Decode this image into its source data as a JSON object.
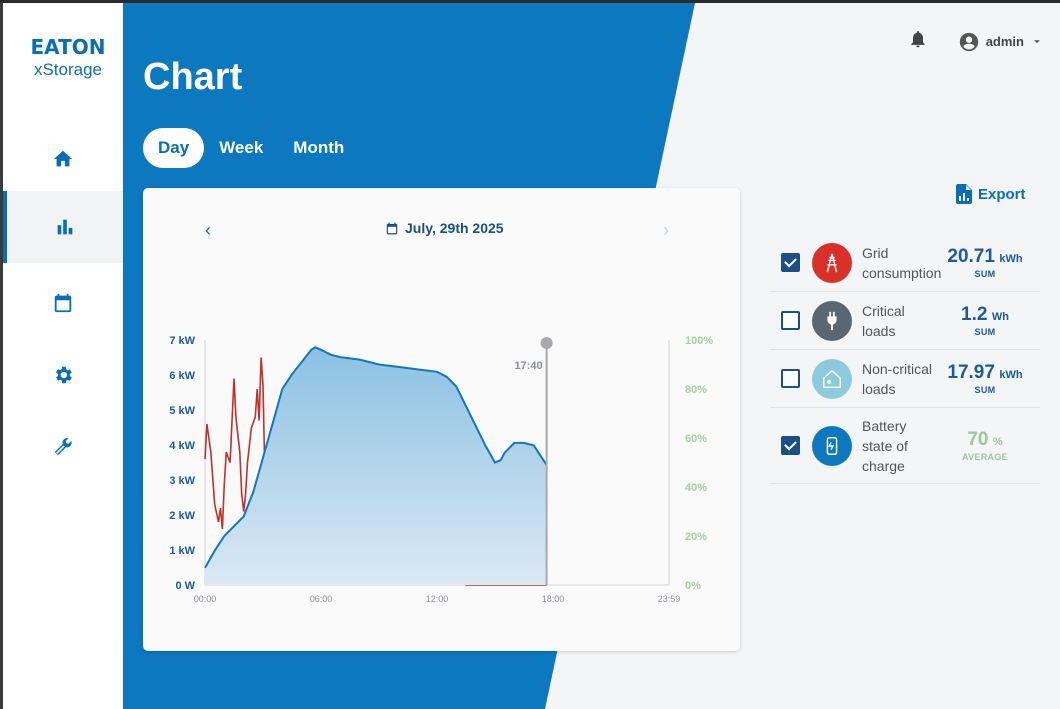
{
  "app": {
    "brand": "EATON",
    "product": "xStorage"
  },
  "header": {
    "user": "admin"
  },
  "page": {
    "title": "Chart"
  },
  "tabs": [
    {
      "label": "Day",
      "active": true
    },
    {
      "label": "Week",
      "active": false
    },
    {
      "label": "Month",
      "active": false
    }
  ],
  "date": {
    "label": "July, 29th 2025"
  },
  "export": {
    "label": "Export"
  },
  "legend": [
    {
      "label_line1": "Grid",
      "label_line2": "consumption",
      "label_line3": "",
      "value": "20.71",
      "unit": "kWh",
      "sub": "SUM",
      "checked": true,
      "color": "#d9302a",
      "icon": "grid-tower-icon"
    },
    {
      "label_line1": "Critical",
      "label_line2": "loads",
      "label_line3": "",
      "value": "1.2",
      "unit": "Wh",
      "sub": "SUM",
      "checked": false,
      "color": "#5a6670",
      "icon": "plug-icon"
    },
    {
      "label_line1": "Non-critical",
      "label_line2": "loads",
      "label_line3": "",
      "value": "17.97",
      "unit": "kWh",
      "sub": "SUM",
      "checked": false,
      "color": "#8ccbdd",
      "icon": "house-icon"
    },
    {
      "label_line1": "Battery",
      "label_line2": "state of",
      "label_line3": "charge",
      "value": "70",
      "unit": "%",
      "sub": "AVERAGE",
      "checked": true,
      "color": "#0b78bf",
      "icon": "battery-icon"
    }
  ],
  "chart_data": {
    "type": "line",
    "x_unit": "hours",
    "xlim": [
      0,
      24
    ],
    "x_tick_labels": [
      "00:00",
      "06:00",
      "12:00",
      "18:00",
      "23:59"
    ],
    "x_tick_values": [
      0,
      6,
      12,
      18,
      24
    ],
    "left_axis": {
      "ylim": [
        0,
        7
      ],
      "tick_labels": [
        "0 W",
        "1 kW",
        "2 kW",
        "3 kW",
        "4 kW",
        "5 kW",
        "6 kW",
        "7 kW"
      ],
      "tick_values": [
        0,
        1,
        2,
        3,
        4,
        5,
        6,
        7
      ]
    },
    "right_axis": {
      "ylim": [
        0,
        100
      ],
      "tick_labels": [
        "0%",
        "20%",
        "40%",
        "60%",
        "80%",
        "100%"
      ],
      "tick_values": [
        0,
        20,
        40,
        60,
        80,
        100
      ]
    },
    "cursor": {
      "x": 17.67,
      "label": "17:40"
    },
    "series": [
      {
        "name": "Grid consumption",
        "axis": "left",
        "style": "line",
        "color": "#c0302b",
        "x": [
          0,
          0.1,
          0.3,
          0.5,
          0.7,
          0.8,
          0.9,
          1.0,
          1.1,
          1.3,
          1.5,
          1.6,
          1.8,
          1.9,
          2.0,
          2.1,
          2.2,
          2.4,
          2.6,
          2.7,
          2.8,
          2.9,
          3.0,
          3.1,
          3.2,
          3.3,
          3.4,
          3.6,
          3.8,
          4.0,
          4.5,
          5.0,
          5.5,
          6.0,
          6.5,
          7.0,
          7.5,
          8.0,
          8.5,
          9.0,
          9.5,
          10.0,
          10.5,
          10.8,
          11.0,
          11.2,
          11.5,
          11.8,
          12.0,
          12.3,
          12.5,
          12.7,
          12.9,
          13.1,
          13.3,
          13.5,
          14.0,
          15.0,
          16.0,
          17.0,
          17.67
        ],
        "y": [
          3.6,
          4.6,
          3.8,
          2.3,
          1.8,
          2.2,
          1.6,
          2.9,
          3.8,
          3.5,
          5.9,
          4.8,
          3.8,
          2.6,
          2.1,
          2.6,
          3.5,
          4.5,
          4.8,
          5.6,
          4.7,
          6.5,
          5.7,
          3.1,
          2.6,
          2.8,
          2.2,
          0.7,
          0.9,
          0.8,
          0.6,
          0.8,
          0.5,
          0.7,
          0.5,
          0.8,
          0.6,
          0.7,
          0.6,
          0.8,
          0.5,
          0.7,
          0.9,
          0.5,
          0.8,
          2.2,
          0.7,
          0.8,
          0.7,
          0.9,
          2.7,
          0.9,
          0.8,
          2.0,
          0.9,
          0.0,
          0.0,
          0.0,
          0.0,
          0.0,
          0.0
        ]
      },
      {
        "name": "Battery state of charge",
        "axis": "right",
        "style": "area",
        "color": "#1477bd",
        "x": [
          0,
          0.5,
          1.0,
          1.5,
          2.0,
          2.5,
          3.0,
          3.5,
          4.0,
          4.5,
          5.0,
          5.5,
          5.7,
          6.0,
          6.5,
          7.0,
          8.0,
          9.0,
          10.0,
          11.0,
          12.0,
          12.5,
          13.0,
          13.5,
          14.0,
          14.5,
          15.0,
          15.3,
          15.5,
          16.0,
          16.5,
          17.0,
          17.67
        ],
        "y": [
          7,
          14,
          20,
          24,
          28,
          38,
          52,
          66,
          80,
          86,
          91,
          96,
          97,
          96,
          94,
          93,
          92,
          90,
          89,
          88,
          87,
          85,
          81,
          73,
          65,
          57,
          50,
          51,
          54,
          58,
          58,
          57,
          49
        ]
      }
    ]
  }
}
